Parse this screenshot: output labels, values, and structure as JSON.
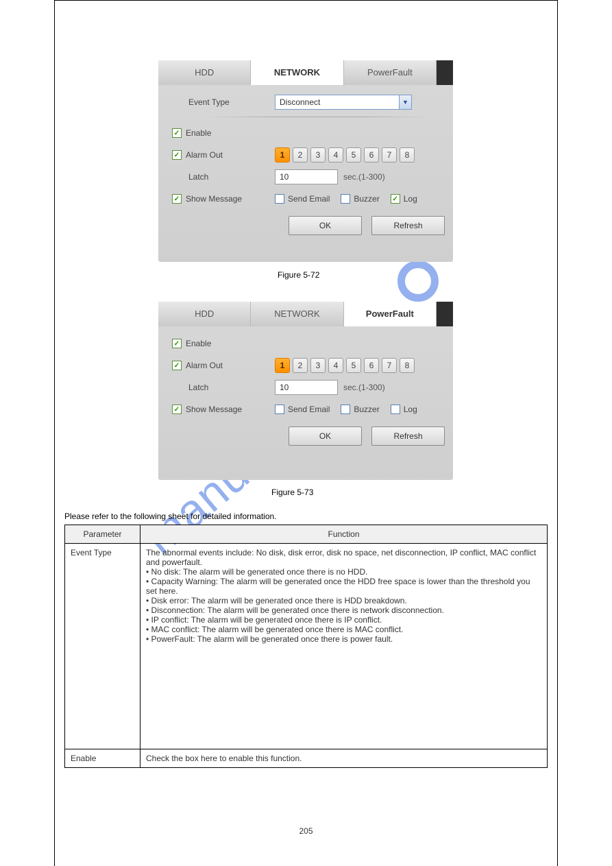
{
  "tabs": {
    "hdd": "HDD",
    "network": "NETWORK",
    "powerfault": "PowerFault"
  },
  "labels": {
    "event_type": "Event Type",
    "enable": "Enable",
    "alarm_out": "Alarm Out",
    "latch": "Latch",
    "show_message": "Show Message",
    "send_email": "Send Email",
    "buzzer": "Buzzer",
    "log": "Log",
    "sec_range": "sec.(1-300)",
    "ok": "OK",
    "refresh": "Refresh"
  },
  "panel1": {
    "event_type_value": "Disconnect",
    "latch_value": "10",
    "alarm_selected": 1,
    "alarm_buttons": [
      "1",
      "2",
      "3",
      "4",
      "5",
      "6",
      "7",
      "8"
    ],
    "log_checked": true
  },
  "panel2": {
    "latch_value": "10",
    "alarm_selected": 1,
    "alarm_buttons": [
      "1",
      "2",
      "3",
      "4",
      "5",
      "6",
      "7",
      "8"
    ],
    "log_checked": false
  },
  "captions": {
    "fig1": "Figure 5-72",
    "fig2": "Figure 5-73",
    "see": "Please refer to the following sheet for detailed information."
  },
  "table": {
    "h1": "Parameter",
    "h2": "Function",
    "r1c1": "Event Type",
    "r1c2": "The abnormal events include: No disk, disk error, disk no space, net disconnection, IP conflict, MAC conflict and powerfault.\n• No disk: The alarm will be generated once there is no HDD.\n• Capacity Warning: The alarm will be generated once the HDD free space is lower than the threshold you set here.\n• Disk error: The alarm will be generated once there is HDD breakdown.\n• Disconnection: The alarm will be generated once there is network disconnection.\n• IP conflict: The alarm will be generated once there is IP conflict.\n• MAC conflict: The alarm will be generated once there is MAC conflict.\n• PowerFault: The alarm will be generated once there is power fault.",
    "r2c1": "Enable",
    "r2c2": "Check the box here to enable this function."
  },
  "watermark": "manualshive.com",
  "pagenum": "205"
}
